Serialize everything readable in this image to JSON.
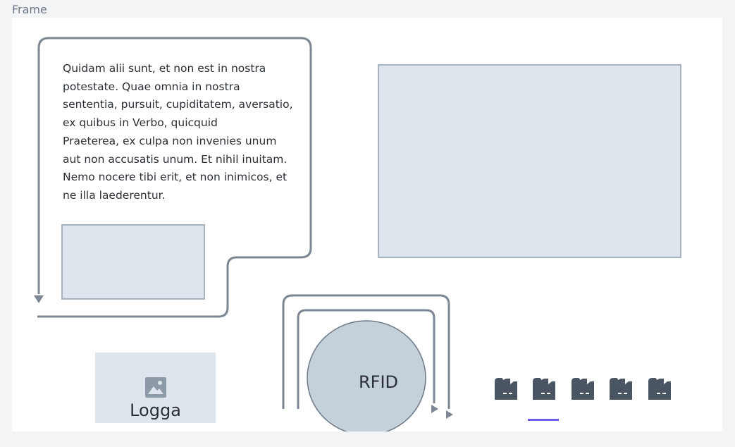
{
  "frame": {
    "label": "Frame"
  },
  "text_block": {
    "paragraph_1": "Quidam alii sunt, et non est in nostra potestate. Quae omnia in nostra sententia, pursuit, cupiditatem, aversatio, ex quibus in Verbo, quicquid",
    "paragraph_2": "Praeterea, ex culpa non invenies unum aut non accusatis unum. Et nihil inuitam. Nemo nocere tibi erit, et non inimicos, et ne illa laederentur."
  },
  "logo": {
    "label": "Logga",
    "icon": "image-icon"
  },
  "rfid": {
    "label": "RFID"
  },
  "factory_icons": [
    {
      "icon": "factory-icon",
      "selected": false
    },
    {
      "icon": "factory-icon",
      "selected": true
    },
    {
      "icon": "factory-icon",
      "selected": false
    },
    {
      "icon": "factory-icon",
      "selected": false
    },
    {
      "icon": "factory-icon",
      "selected": false
    }
  ],
  "colors": {
    "stroke": "#7c8793",
    "placeholder_fill": "#dfe5ec",
    "placeholder_border": "#a7b4c0",
    "circle_fill": "#c4d0da",
    "factory": "#4a5563",
    "selected_underline": "#6c5ce7"
  }
}
